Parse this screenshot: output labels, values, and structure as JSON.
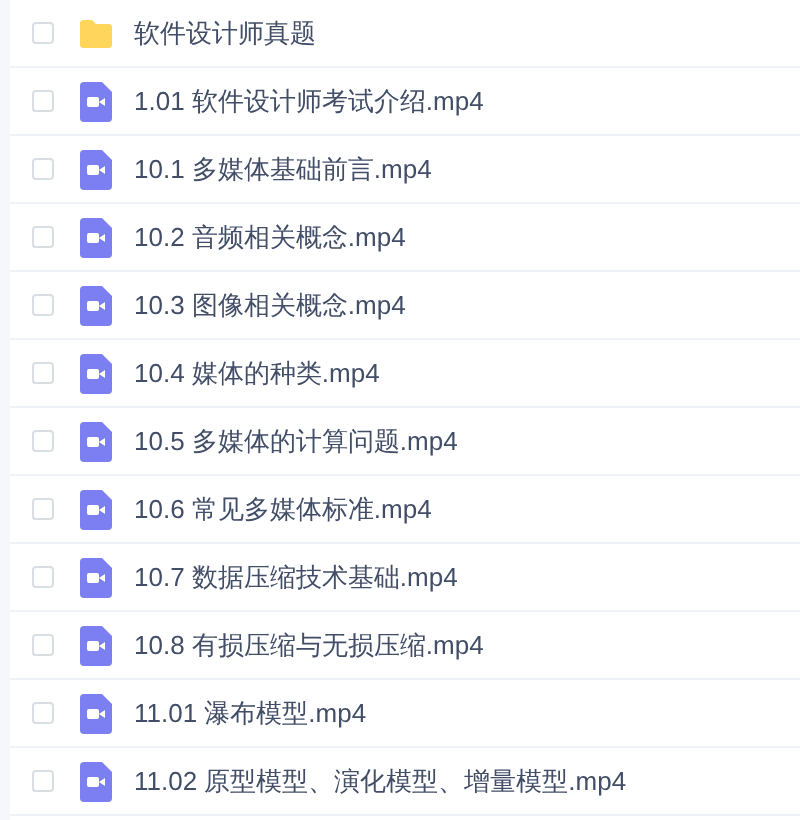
{
  "files": [
    {
      "kind": "folder",
      "name": "软件设计师真题",
      "checked": false
    },
    {
      "kind": "video",
      "name": "1.01 软件设计师考试介绍.mp4",
      "checked": false
    },
    {
      "kind": "video",
      "name": "10.1 多媒体基础前言.mp4",
      "checked": false
    },
    {
      "kind": "video",
      "name": "10.2 音频相关概念.mp4",
      "checked": false
    },
    {
      "kind": "video",
      "name": "10.3 图像相关概念.mp4",
      "checked": false
    },
    {
      "kind": "video",
      "name": "10.4 媒体的种类.mp4",
      "checked": false
    },
    {
      "kind": "video",
      "name": "10.5 多媒体的计算问题.mp4",
      "checked": false
    },
    {
      "kind": "video",
      "name": "10.6 常见多媒体标准.mp4",
      "checked": false
    },
    {
      "kind": "video",
      "name": "10.7 数据压缩技术基础.mp4",
      "checked": false
    },
    {
      "kind": "video",
      "name": "10.8 有损压缩与无损压缩.mp4",
      "checked": false
    },
    {
      "kind": "video",
      "name": "11.01 瀑布模型.mp4",
      "checked": false
    },
    {
      "kind": "video",
      "name": "11.02 原型模型、演化模型、增量模型.mp4",
      "checked": false
    }
  ]
}
